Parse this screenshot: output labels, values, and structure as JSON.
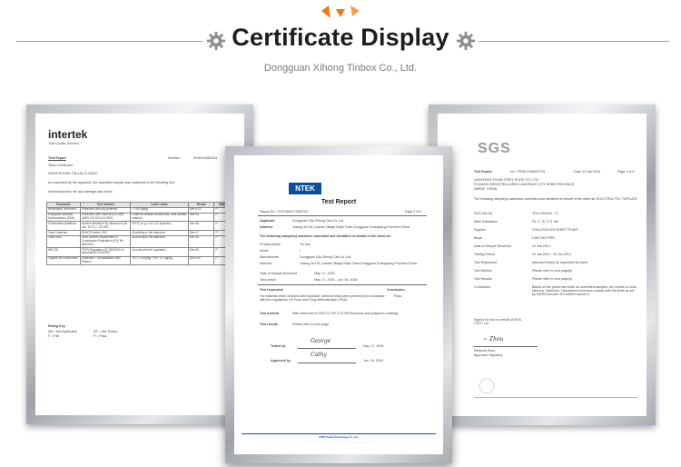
{
  "header": {
    "title": "Certificate Display",
    "subtitle": "Dongguan Xihong Tinbox Co., Ltd."
  },
  "colors": {
    "accent": "#f07a1a",
    "ntek_blue": "#0b4f9c"
  },
  "cert_intertek": {
    "logo": "intertek",
    "logo_sub": "Total Quality. Assured.",
    "test_report": "Test Report",
    "number_label": "Number:",
    "number": "SHAH01662524",
    "tests_conducted": "Tests Conducted",
    "sample": "NIVEA ROUND TIN-LID-CLASSIC",
    "line1": "As requested by the applicant, the submitted sample was subjected to the following test.",
    "line2": "Initial inspection: No any damage was found.",
    "table_headers": [
      "Parameter",
      "Test method",
      "Limit / value",
      "Result",
      "Rating"
    ],
    "table_rows": [
      [
        "Hexavalent chromium",
        "Extraction with pig synthetic",
        "< 100 mg/kg",
        "See #1/2",
        "P"
      ],
      [
        "Polycyclic Aromatic Hydrocarbons (PAH)",
        "Extraction with Toluene (GC-MS) (AfPS GS 2014:01 PAH)",
        "Limits for articles except toys, food contact material",
        "See #4",
        "P"
      ],
      [
        "Chlorinated paraffines",
        "solvent extraction by ultrasound (30 min, 60°C) + GC-MS",
        "SVHC (e.g. C10-C13 Species)",
        "See #6",
        "P"
      ],
      [
        "Total Cadmium",
        "REACH Annex XVII",
        "According to the standard",
        "See #7",
        "P"
      ],
      [
        "Total Lead",
        "Lead content requirement in Commission Regulation (EU) No 836/2012",
        "According to the standard",
        "See #8",
        "P"
      ],
      [
        "HBCDD",
        "POPs Regulation EC 850/2004 & amendment 2016/293",
        "Comply with the regulation",
        "See #9",
        "P"
      ],
      [
        "Organic tin compounds",
        "Extraction / Derivatization with Ethanol",
        "TBT 1.0 mg/kg TPhT 1.0 mg/kg",
        "See #10",
        "P"
      ]
    ],
    "rating_key_title": "Rating Key",
    "rating_key": [
      "NA = Not Applicable",
      "NT = Not Tested",
      "F = Fail",
      "P = Pass"
    ]
  },
  "cert_ntek": {
    "logo": "NTEK",
    "title": "Test Report",
    "report_no": "Report No.: DGF18051715087D2",
    "page": "Page 2 of 2",
    "applicant_label": "Applicant",
    "applicant": "Dongguan City Xihong Can Co.,Ltd.",
    "address_label": "Address",
    "address": "Jiulong 3rd St.,Liaoxia Village,Shijie Town,Dongguan Guangdong Province,China",
    "notice": "The following sample(s) was/were submitted and identified on behalf of the client as:",
    "fields": [
      [
        "Product Name",
        "Tin box"
      ],
      [
        "Model",
        "/"
      ],
      [
        "Manufacturer",
        "Dongguan City Xihong Can Co.,Ltd."
      ],
      [
        "Address",
        "Jiulong 3rd St.,Liaoxia Village,Shijie Town,Dongguan Guangdong Province,China"
      ]
    ],
    "date_receipt_label": "Date of Sample Received",
    "date_receipt": "May. 17, 2018",
    "test_period_label": "Test period",
    "test_period": "May. 17, 2018 - Jun. 04, 2018",
    "test_requested_label": "Test requested:",
    "conclusion_label": "Conclusion:",
    "test_requested": "For material which contacts with foodstuff, selected tests were performed for compliant with the regulations US Food and Drug Administration (FDA).",
    "conclusion": "Pass",
    "test_method_label": "Test method",
    "test_method": "With reference to FDA 21 CFR 175.300 Resinous and polymeric coatings.",
    "test_results_label": "Test results",
    "test_results": "Please refer to next page.",
    "tested_by_label": "Tested by",
    "tested_date": "May. 17, 2018",
    "approved_by_label": "Approved by",
    "approved_date": "Jun. 04, 2018",
    "footer": "NTEK Testing Technology Co., Ltd."
  },
  "cert_sgs": {
    "logo": "SGS",
    "test_report": "Test Report",
    "no": "No. TSNEC1400027701",
    "date": "Date: 15 Jan 2014",
    "page": "Page 1 of 5",
    "company": "LANGFANG FUXIN STEEL PLATE CO.,LTD.",
    "company_addr": "FUQIANG INDUSTRIAL AREA LANGFANG CITY HEBEI PROVINCE",
    "company_zip": "065000, CHINA",
    "intro": "The following sample(s) was/were submitted and identified on behalf of the client as: ELECTROLYTIC TINPLATE",
    "fields": [
      [
        "SGS Job No.",
        "TP14-000102 - TJ"
      ],
      [
        "Main Substance",
        "Fe, C, Si, P, S, Mn"
      ],
      [
        "Supplier",
        "COLD-ROLLED SHEET PLANT"
      ],
      [
        "Buyer",
        "CAN FACTORY"
      ],
      [
        "Date of Sample Received",
        "10 Jan 2014"
      ],
      [
        "Testing Period",
        "10 Jan 2014 - 15 Jan 2014"
      ],
      [
        "Test Requested",
        "Selected test(s) as requested by client"
      ],
      [
        "Test Method",
        "Please refer to next page(s)"
      ],
      [
        "Test Results",
        "Please refer to next page(s)"
      ],
      [
        "Conclusion",
        "Based on the performed tests on submitted samples, the results of Lead, Mercury, Cadmium, Hexavalent chromium comply with the limits as set by RoHS Directive 2011/65/EU Annex II"
      ]
    ],
    "signed": "Signed for and on behalf of SGS-CSTC Ltd.",
    "signer": "Rebecca Zhou",
    "signer_title": "Approved Signatory"
  }
}
